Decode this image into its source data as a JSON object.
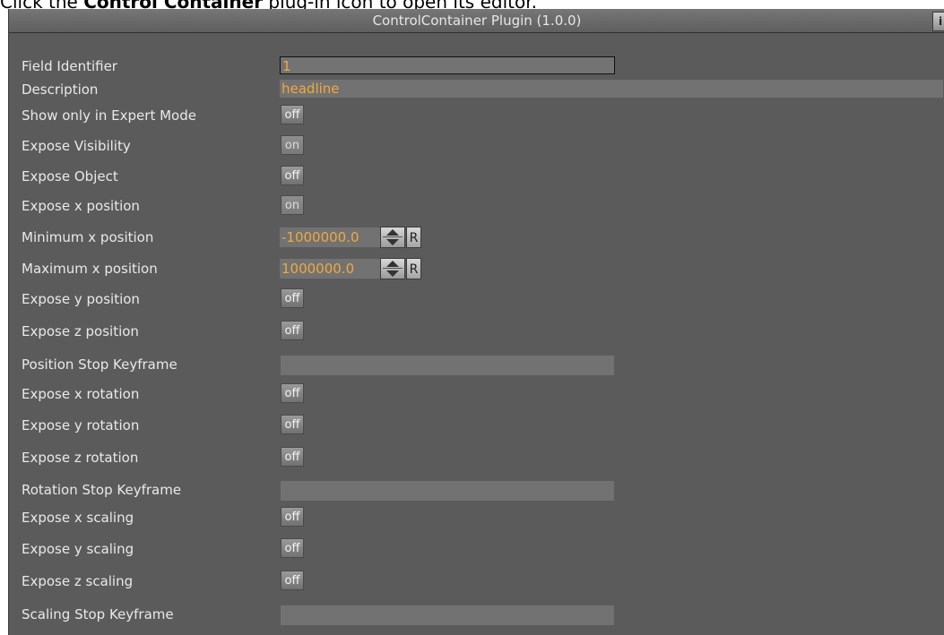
{
  "instruction": {
    "prefix": "Click the ",
    "bold": "Control Container",
    "suffix": " plug-in icon to open its editor."
  },
  "panel": {
    "title": "ControlContainer Plugin (1.0.0)",
    "corner_button": "i"
  },
  "rows": {
    "field_identifier": {
      "label": "Field Identifier",
      "value": "1"
    },
    "description": {
      "label": "Description",
      "value": "headline"
    },
    "show_expert": {
      "label": "Show only in Expert Mode",
      "state": "off"
    },
    "expose_visibility": {
      "label": "Expose Visibility",
      "state": "on"
    },
    "expose_object": {
      "label": "Expose Object",
      "state": "off"
    },
    "expose_x_position": {
      "label": "Expose x position",
      "state": "on"
    },
    "min_x_position": {
      "label": "Minimum x position",
      "value": "-1000000.0",
      "reset": "R"
    },
    "max_x_position": {
      "label": "Maximum x position",
      "value": "1000000.0",
      "reset": "R"
    },
    "expose_y_position": {
      "label": "Expose y position",
      "state": "off"
    },
    "expose_z_position": {
      "label": "Expose z position",
      "state": "off"
    },
    "position_stop": {
      "label": "Position Stop Keyframe",
      "value": ""
    },
    "expose_x_rotation": {
      "label": "Expose x rotation",
      "state": "off"
    },
    "expose_y_rotation": {
      "label": "Expose y rotation",
      "state": "off"
    },
    "expose_z_rotation": {
      "label": "Expose z rotation",
      "state": "off"
    },
    "rotation_stop": {
      "label": "Rotation Stop Keyframe",
      "value": ""
    },
    "expose_x_scaling": {
      "label": "Expose x scaling",
      "state": "off"
    },
    "expose_y_scaling": {
      "label": "Expose y scaling",
      "state": "off"
    },
    "expose_z_scaling": {
      "label": "Expose z scaling",
      "state": "off"
    },
    "scaling_stop": {
      "label": "Scaling Stop Keyframe",
      "value": ""
    }
  },
  "colors": {
    "panel_bg": "#5b5b5b",
    "value_text": "#f2a93b",
    "label_text": "#e9e9e9"
  }
}
